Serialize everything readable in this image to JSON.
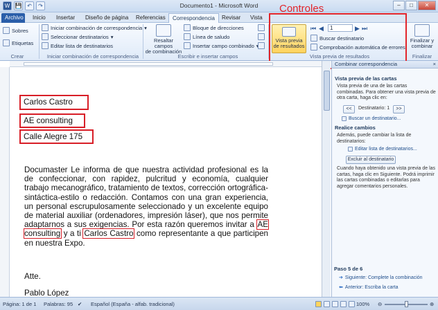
{
  "window": {
    "title": "Documento1 - Microsoft Word"
  },
  "annotation": {
    "label": "Controles"
  },
  "qat": {
    "save": "💾",
    "undo": "↶",
    "redo": "↷"
  },
  "tabs": [
    "Archivo",
    "Inicio",
    "Insertar",
    "Diseño de página",
    "Referencias",
    "Correspondencia",
    "Revisar",
    "Vista"
  ],
  "ribbon": {
    "crear": {
      "sobres": "Sobres",
      "etiquetas": "Etiquetas",
      "label": "Crear"
    },
    "inicio_comb": {
      "iniciar": "Iniciar combinación de correspondencia",
      "seleccionar": "Seleccionar destinatarios",
      "editar": "Editar lista de destinatarios",
      "label": "Iniciar combinación de correspondencia"
    },
    "escribir": {
      "resaltar_line1": "Resaltar campos",
      "resaltar_line2": "de combinación",
      "bloque": "Bloque de direcciones",
      "linea": "Línea de saludo",
      "insertar": "Insertar campo combinado",
      "label": "Escribir e insertar campos"
    },
    "vista_previa": {
      "btn_line1": "Vista previa",
      "btn_line2": "de resultados",
      "record": "1",
      "buscar": "Buscar destinatario",
      "comprobacion": "Comprobación automática de errores",
      "label": "Vista previa de resultados"
    },
    "finalizar": {
      "line1": "Finalizar y",
      "line2": "combinar",
      "label": "Finalizar"
    }
  },
  "document": {
    "name": "Carlos Castro",
    "company": "AE consulting",
    "address": "Calle Alegre 175",
    "body_part1": "Documaster Le informa de que nuestra actividad profesional es la de confeccionar, con rapidez, pulcritud y economía, cualquier trabajo mecanográfico, tratamiento de textos, corrección ortográfica-sintáctica-estilo o redacción. Contamos con una gran experiencia, un personal escrupulosamente seleccionado y un excelente equipo de material auxiliar (ordenadores, impresión láser), que nos permite adaptarnos a sus exigencias. Por esta razón queremos invitar a ",
    "body_company": "AE consulting",
    "body_part2": " y a ti ",
    "body_name": "Carlos Castro",
    "body_part3": " como representante a que participen en nuestra Expo.",
    "closing": "Atte.",
    "signature": "Pablo López"
  },
  "pane": {
    "title": "Combinar correspondencia",
    "section1": "Vista previa de las cartas",
    "desc1": "Vista previa de una de las cartas combinadas. Para obtener una vista previa de otra carta, haga clic en:",
    "prev": "<<",
    "dest": "Destinatario: 1",
    "next": ">>",
    "buscar": "Buscar un destinatario...",
    "section2": "Realice cambios",
    "desc2": "Además, puede cambiar la lista de destinatarios:",
    "editar": "Editar lista de destinatarios...",
    "excluir": "Excluir al destinatario",
    "desc3": "Cuando haya obtenido una vista previa de las cartas, haga clic en Siguiente. Podrá imprimir las cartas combinadas o editarlas para agregar comentarios personales.",
    "step": "Paso 5 de 6",
    "siguiente": "Siguiente: Complete la combinación",
    "anterior": "Anterior: Escriba la carta"
  },
  "status": {
    "page": "Página: 1 de 1",
    "words": "Palabras: 95",
    "lang": "Español (España - alfab. tradicional)",
    "zoom": "100%"
  }
}
